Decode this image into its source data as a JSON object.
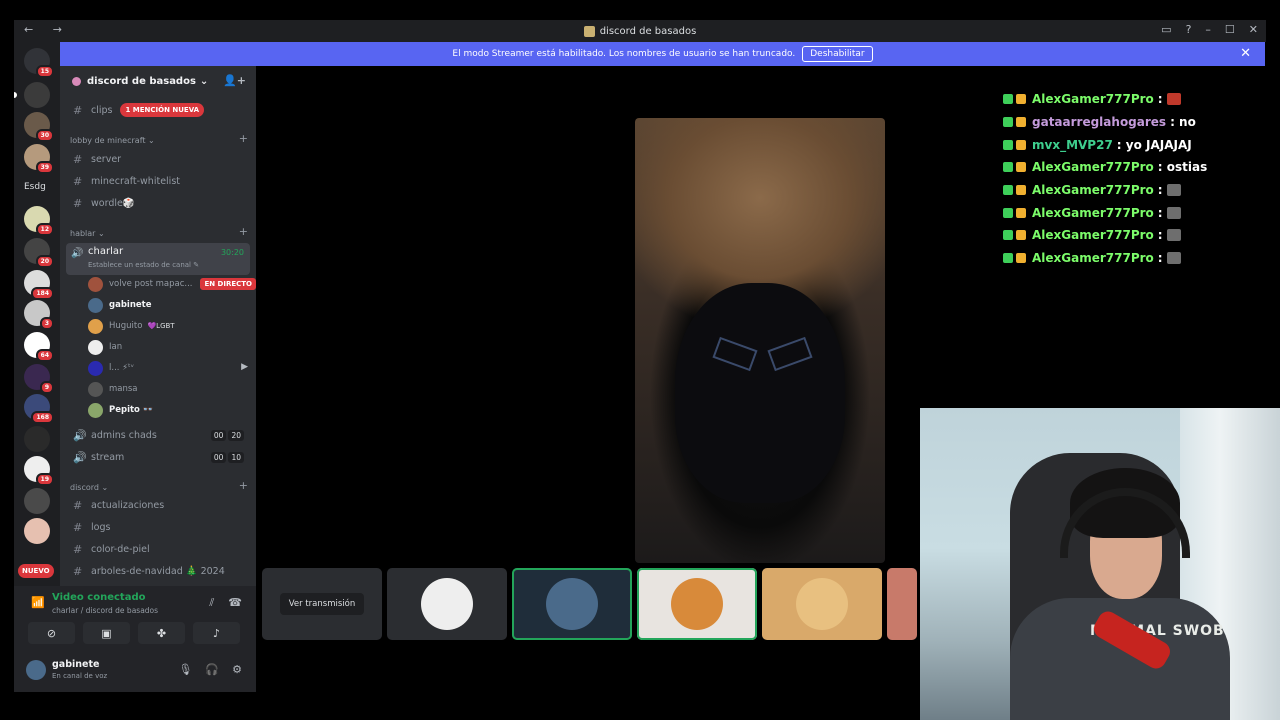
{
  "window": {
    "title": "discord de basados",
    "nav": "← →",
    "controls": [
      "▭",
      "?",
      "–",
      "☐",
      "✕"
    ]
  },
  "streamer_banner": {
    "text": "El modo Streamer está habilitado. Los nombres de usuario se han truncado.",
    "button": "Deshabilitar",
    "close": "✕"
  },
  "server_rail": {
    "top_badge": "15",
    "text_server": "Esdg",
    "new_badge": "NUEVO",
    "badges": [
      "30",
      "39",
      "12",
      "20",
      "184",
      "3",
      "64",
      "9",
      "168",
      "19"
    ]
  },
  "guild": {
    "name": "discord de basados",
    "chevron": "⌄",
    "invite_icon": "👤+"
  },
  "channels": {
    "clips": {
      "name": "clips",
      "mention": "1 MENCIÓN NUEVA"
    },
    "categories": {
      "lobby": "lobby de minecraft",
      "hablar": "hablar",
      "discord": "discord"
    },
    "lobby_channels": [
      "server",
      "minecraft-whitelist",
      "wordle🎲"
    ],
    "active_voice": {
      "name": "charlar",
      "status": "Establece un estado de canal ✎",
      "timer": "30:20"
    },
    "voice_users": [
      {
        "name": "volve post mapac...",
        "badge": "EN DIRECTO"
      },
      {
        "name": "gabinete"
      },
      {
        "name": "Huguito",
        "tag": "💜LGBT"
      },
      {
        "name": "Ian"
      },
      {
        "name": "l... ⚡ᵗᵛ"
      },
      {
        "name": "mansa"
      },
      {
        "name": "Pepito 👓"
      }
    ],
    "other_voice": [
      {
        "name": "admins chads",
        "counts": [
          "00",
          "20"
        ]
      },
      {
        "name": "stream",
        "counts": [
          "00",
          "10"
        ]
      }
    ],
    "discord_channels": [
      "actualizaciones",
      "logs",
      "color-de-piel",
      "arboles-de-navidad 🎄 2024"
    ]
  },
  "voice_panel": {
    "title": "Video conectado",
    "subtitle": "charlar / discord de basados",
    "user": {
      "name": "gabinete",
      "status": "En canal de voz"
    }
  },
  "stage": {
    "watch_button": "Ver transmisión"
  },
  "chat": [
    {
      "user": "AlexGamer777Pro",
      "text": ":",
      "color": "#7cfc6a",
      "emote": "#c0392b"
    },
    {
      "user": "gataarreglahogares",
      "text": ": no",
      "color": "#c49bdb",
      "emote": null
    },
    {
      "user": "mvx_MVP27",
      "text": ": yo JAJAJAJ",
      "color": "#3ecf8e",
      "emote": null
    },
    {
      "user": "AlexGamer777Pro",
      "text": ": ostias",
      "color": "#7cfc6a",
      "emote": null
    },
    {
      "user": "AlexGamer777Pro",
      "text": ":",
      "color": "#7cfc6a",
      "emote": "#6e6e6e"
    },
    {
      "user": "AlexGamer777Pro",
      "text": ":",
      "color": "#7cfc6a",
      "emote": "#6e6e6e"
    },
    {
      "user": "AlexGamer777Pro",
      "text": ":",
      "color": "#7cfc6a",
      "emote": "#6e6e6e"
    },
    {
      "user": "AlexGamer777Pro",
      "text": ":",
      "color": "#7cfc6a",
      "emote": "#6e6e6e"
    }
  ],
  "webcam": {
    "shirt_text": "MINIMAL SWOB"
  },
  "colors": {
    "accent": "#5865f2",
    "danger": "#da373c",
    "online": "#23a55a"
  }
}
